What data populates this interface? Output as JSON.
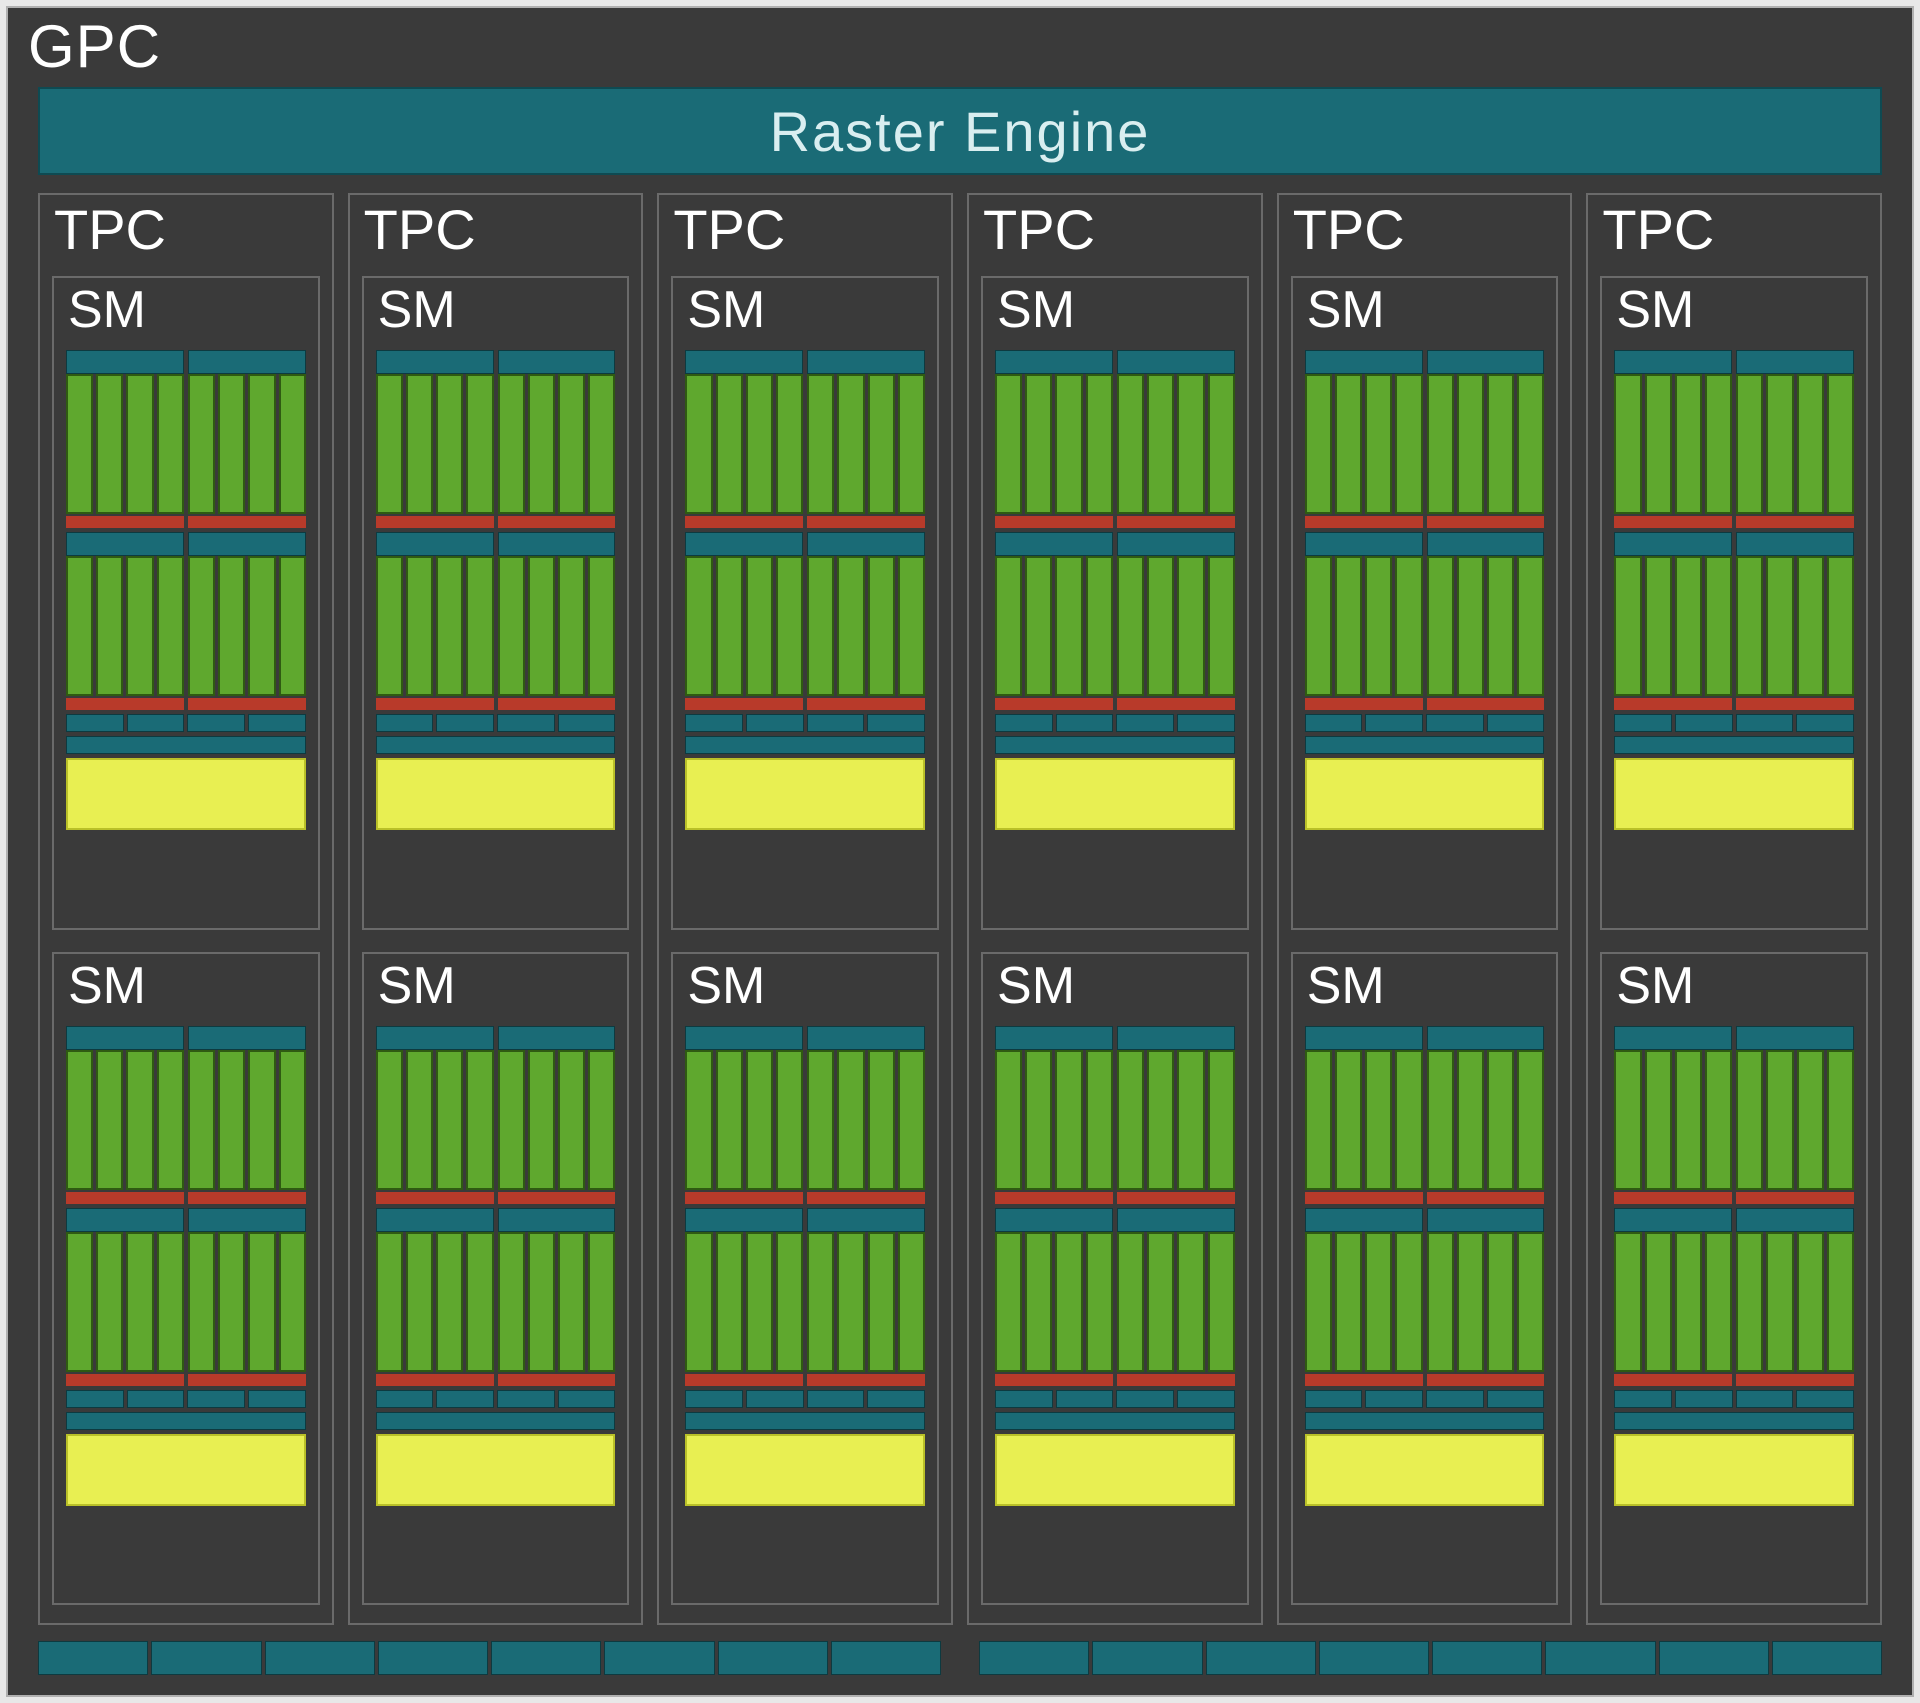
{
  "gpc": {
    "label": "GPC",
    "raster_label": "Raster Engine",
    "tpc_count": 6,
    "tpc_label": "TPC",
    "sm_per_tpc": 2,
    "sm_label": "SM",
    "sm_structure": {
      "partitions_per_sm": 4,
      "partition_pairs": 2,
      "core_columns_per_partition": 4,
      "has_scheduler_bar": true,
      "has_red_bar": true,
      "has_cache_segment_row": true,
      "has_cache_bar": true,
      "has_shared_memory_block": true
    },
    "bottom_bar_groups": 2,
    "bottom_bar_segments_per_group": 8,
    "colors": {
      "background": "#3a3a3a",
      "border_light": "#6a6a6a",
      "teal": "#1a6b76",
      "green": "#5fa82e",
      "red": "#b83a2a",
      "yellow": "#e8ef52",
      "text": "#ffffff"
    }
  }
}
